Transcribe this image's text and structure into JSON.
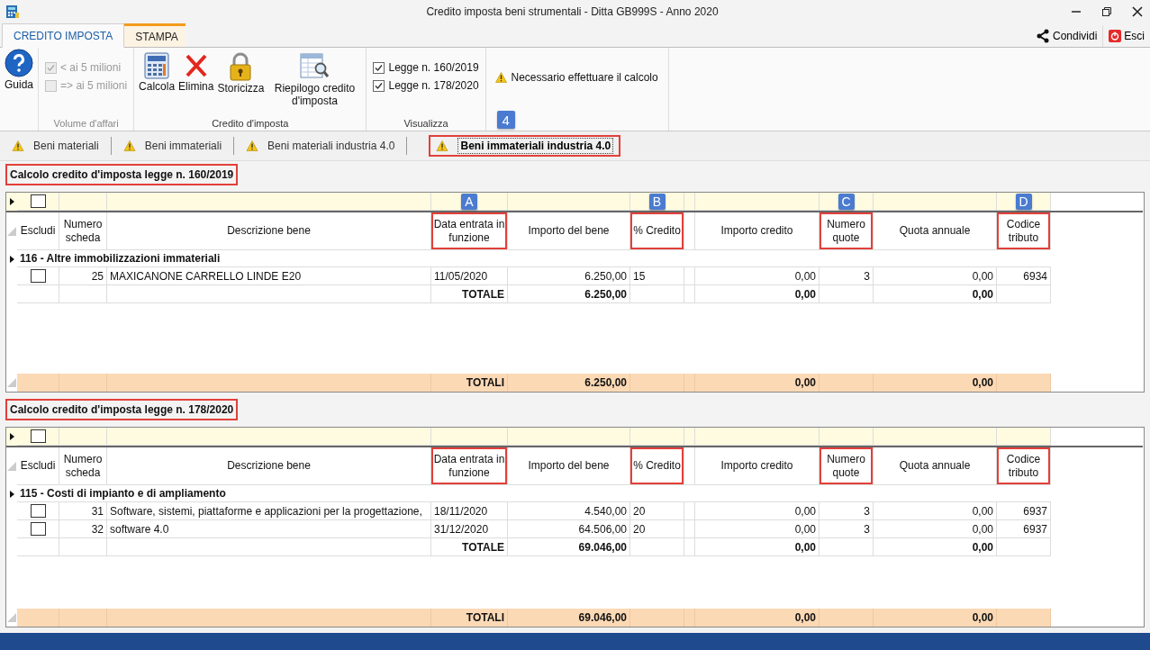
{
  "window": {
    "title": "Credito imposta beni strumentali - Ditta GB999S - Anno 2020"
  },
  "ribbon_tabs": [
    {
      "label": "CREDITO IMPOSTA",
      "selected": true
    },
    {
      "label": "STAMPA",
      "selected": false
    }
  ],
  "ribbon_actions": [
    {
      "label": "Condividi",
      "kind": "share"
    },
    {
      "label": "Esci",
      "kind": "exit"
    }
  ],
  "guida": {
    "label": "Guida"
  },
  "volume": {
    "caption": "Volume d'affari",
    "options": [
      {
        "label": "< ai 5 milioni",
        "checked": true,
        "disabled": true
      },
      {
        "label": "=> ai 5 milioni",
        "checked": false,
        "disabled": true
      }
    ]
  },
  "credito": {
    "caption": "Credito d'imposta",
    "buttons": [
      {
        "label": "Calcola",
        "kind": "calculator"
      },
      {
        "label": "Elimina",
        "kind": "cross"
      },
      {
        "label": "Storicizza",
        "kind": "lock"
      },
      {
        "label": "Riepilogo credito d'imposta",
        "kind": "report"
      }
    ]
  },
  "visualizza": {
    "caption": "Visualizza",
    "options": [
      {
        "label": "Legge n. 160/2019",
        "checked": true
      },
      {
        "label": "Legge n. 178/2020",
        "checked": true
      }
    ]
  },
  "notice": {
    "text": "Necessario effettuare il calcolo",
    "badge": "4"
  },
  "doc_tabs": [
    {
      "label": "Beni materiali",
      "selected": false,
      "highlighted": false
    },
    {
      "label": "Beni immateriali",
      "selected": false,
      "highlighted": false
    },
    {
      "label": "Beni materiali industria 4.0",
      "selected": false,
      "highlighted": false
    },
    {
      "label": "Beni immateriali industria 4.0",
      "selected": true,
      "highlighted": true
    }
  ],
  "sections": [
    {
      "title": "Calcolo credito d'imposta legge n. 160/2019",
      "highlighted": true,
      "filter_checked": false,
      "columns": [
        {
          "label": "Escludi",
          "highlighted": false
        },
        {
          "label": "Numero scheda",
          "highlighted": false
        },
        {
          "label": "Descrizione bene",
          "highlighted": false
        },
        {
          "label": "Data entrata in funzione",
          "highlighted": true,
          "badge": "A"
        },
        {
          "label": "Importo del bene",
          "highlighted": false
        },
        {
          "label": "% Credito",
          "highlighted": true,
          "badge": "B"
        },
        {
          "label": "Importo credito",
          "highlighted": false
        },
        {
          "label": "Numero quote",
          "highlighted": true,
          "badge": "C"
        },
        {
          "label": "Quota annuale",
          "highlighted": false
        },
        {
          "label": "Codice tributo",
          "highlighted": true,
          "badge": "D"
        }
      ],
      "groups": [
        {
          "label": "116 - Altre immobilizzazioni immateriali",
          "rows": [
            {
              "excluded": false,
              "numero": "25",
              "descrizione": "MAXICANONE CARRELLO LINDE E20",
              "data": "11/05/2020",
              "importo_bene": "6.250,00",
              "credito_pct": "15",
              "importo_credito": "0,00",
              "numero_quote": "3",
              "quota_annuale": "0,00",
              "codice": "6934"
            }
          ]
        }
      ],
      "totale": {
        "label": "TOTALE",
        "importo_bene": "6.250,00",
        "importo_credito": "0,00",
        "quota_annuale": "0,00"
      },
      "totali": {
        "label": "TOTALI",
        "importo_bene": "6.250,00",
        "importo_credito": "0,00",
        "quota_annuale": "0,00"
      }
    },
    {
      "title": "Calcolo credito d'imposta legge n. 178/2020",
      "highlighted": true,
      "filter_checked": false,
      "columns": [
        {
          "label": "Escludi",
          "highlighted": false
        },
        {
          "label": "Numero scheda",
          "highlighted": false
        },
        {
          "label": "Descrizione bene",
          "highlighted": false
        },
        {
          "label": "Data entrata in funzione",
          "highlighted": true
        },
        {
          "label": "Importo del bene",
          "highlighted": false
        },
        {
          "label": "% Credito",
          "highlighted": true
        },
        {
          "label": "Importo credito",
          "highlighted": false
        },
        {
          "label": "Numero quote",
          "highlighted": true
        },
        {
          "label": "Quota annuale",
          "highlighted": false
        },
        {
          "label": "Codice tributo",
          "highlighted": true
        }
      ],
      "groups": [
        {
          "label": "115 - Costi di impianto e di ampliamento",
          "rows": [
            {
              "excluded": false,
              "numero": "31",
              "descrizione": "Software, sistemi, piattaforme e applicazioni per la progettazione,",
              "data": "18/11/2020",
              "importo_bene": "4.540,00",
              "credito_pct": "20",
              "importo_credito": "0,00",
              "numero_quote": "3",
              "quota_annuale": "0,00",
              "codice": "6937"
            },
            {
              "excluded": false,
              "numero": "32",
              "descrizione": "software 4.0",
              "data": "31/12/2020",
              "importo_bene": "64.506,00",
              "credito_pct": "20",
              "importo_credito": "0,00",
              "numero_quote": "3",
              "quota_annuale": "0,00",
              "codice": "6937"
            }
          ]
        }
      ],
      "totale": {
        "label": "TOTALE",
        "importo_bene": "69.046,00",
        "importo_credito": "0,00",
        "quota_annuale": "0,00"
      },
      "totali": {
        "label": "TOTALI",
        "importo_bene": "69.046,00",
        "importo_credito": "0,00",
        "quota_annuale": "0,00"
      }
    }
  ]
}
